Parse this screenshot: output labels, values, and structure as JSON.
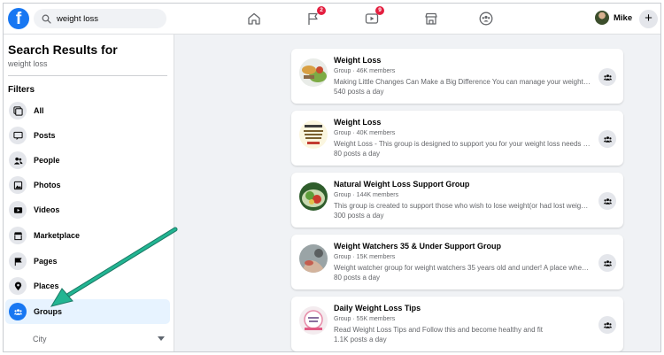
{
  "topbar": {
    "logo": "f",
    "search": {
      "value": "weight loss",
      "icon": "search-icon"
    },
    "nav": [
      {
        "name": "home",
        "icon": "home-icon",
        "badge": ""
      },
      {
        "name": "pages",
        "icon": "flag-icon",
        "badge": "2"
      },
      {
        "name": "watch",
        "icon": "video-icon",
        "badge": "9"
      },
      {
        "name": "marketplace",
        "icon": "marketplace-icon",
        "badge": ""
      },
      {
        "name": "groups",
        "icon": "groups-icon",
        "badge": ""
      }
    ],
    "profile_name": "Mike",
    "create_label": "+"
  },
  "sidebar": {
    "title": "Search Results for",
    "query": "weight loss",
    "filters_label": "Filters",
    "items": [
      {
        "label": "All",
        "icon": "all-icon"
      },
      {
        "label": "Posts",
        "icon": "posts-icon"
      },
      {
        "label": "People",
        "icon": "people-icon"
      },
      {
        "label": "Photos",
        "icon": "photos-icon"
      },
      {
        "label": "Videos",
        "icon": "videos-icon"
      },
      {
        "label": "Marketplace",
        "icon": "marketplace-icon"
      },
      {
        "label": "Pages",
        "icon": "flag-icon"
      },
      {
        "label": "Places",
        "icon": "pin-icon"
      },
      {
        "label": "Groups",
        "icon": "groups-icon",
        "active": true
      }
    ],
    "city_label": "City"
  },
  "results": [
    {
      "title": "Weight Loss",
      "meta": "Group · 46K members",
      "desc": "Making Little Changes Can Make a Big Difference You can manage your weight loss goals",
      "posts": "540 posts a day"
    },
    {
      "title": "Weight Loss",
      "meta": "Group · 40K members",
      "desc": "Weight Loss - This group is designed to support you for your weight loss needs and goals",
      "posts": "80 posts a day"
    },
    {
      "title": "Natural Weight Loss Support Group",
      "meta": "Group · 144K members",
      "desc": "This group is created to support those who wish to lose weight(or had lost weight already",
      "posts": "300 posts a day"
    },
    {
      "title": "Weight Watchers 35 & Under Support Group",
      "meta": "Group · 15K members",
      "desc": "Weight watcher group for weight watchers 35 years old and under! A place where you can",
      "posts": "80 posts a day"
    },
    {
      "title": "Daily Weight Loss Tips",
      "meta": "Group · 55K members",
      "desc": "Read Weight Loss Tips and Follow this and become healthy and fit",
      "posts": "1.1K posts a day"
    }
  ],
  "colors": {
    "brand": "#1877f2",
    "badge": "#e41e3f",
    "arrow": "#1aa88a",
    "active_bg": "#e7f3ff"
  }
}
